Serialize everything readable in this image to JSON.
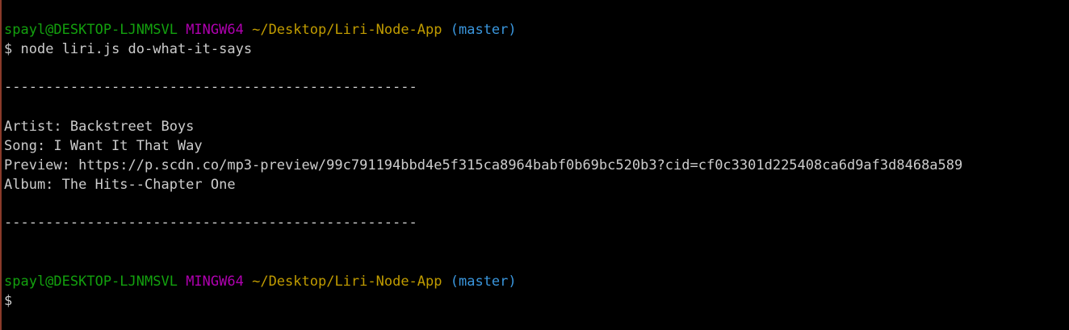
{
  "colors": {
    "background": "#000000",
    "user_host": "#13a10e",
    "shell_name": "#b000b0",
    "path": "#c19c00",
    "branch": "#3a96dd",
    "text": "#cccccc"
  },
  "prompt1": {
    "user_host": "spayl@DESKTOP-LJNMSVL",
    "shell": "MINGW64",
    "path": "~/Desktop/Liri-Node-App",
    "branch": "(master)"
  },
  "command": {
    "symbol": "$",
    "text": "node liri.js do-what-it-says"
  },
  "output": {
    "separator_top": "--------------------------------------------------",
    "artist": "Artist: Backstreet Boys",
    "song": "Song: I Want It That Way",
    "preview": "Preview: https://p.scdn.co/mp3-preview/99c791194bbd4e5f315ca8964babf0b69bc520b3?cid=cf0c3301d225408ca6d9af3d8468a589",
    "album": "Album: The Hits--Chapter One",
    "separator_bottom": "--------------------------------------------------"
  },
  "prompt2": {
    "user_host": "spayl@DESKTOP-LJNMSVL",
    "shell": "MINGW64",
    "path": "~/Desktop/Liri-Node-App",
    "branch": "(master)",
    "symbol": "$"
  }
}
